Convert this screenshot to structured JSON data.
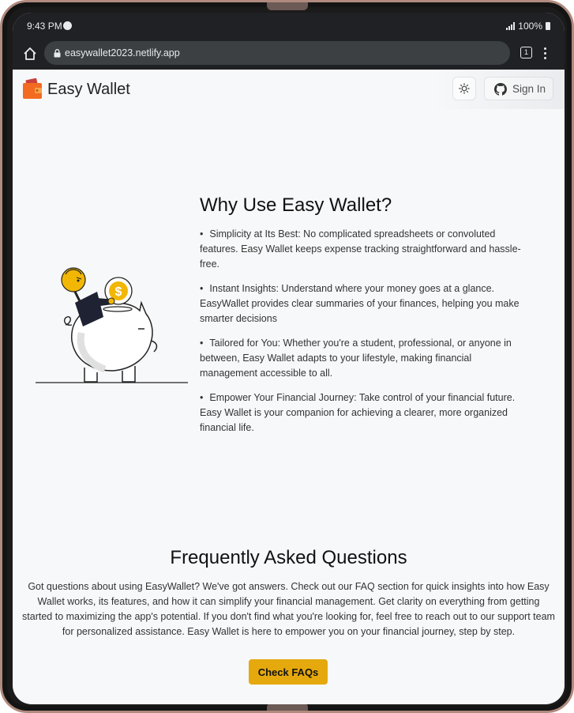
{
  "status_bar": {
    "time": "9:43 PM",
    "battery": "100%"
  },
  "browser": {
    "url": "easywallet2023.netlify.app",
    "tab_count": "1"
  },
  "header": {
    "brand": "Easy Wallet",
    "signin_label": "Sign In"
  },
  "why": {
    "title": "Why Use Easy Wallet?",
    "items": [
      "Simplicity at Its Best: No complicated spreadsheets or convoluted features. Easy Wallet keeps expense tracking straightforward and hassle-free.",
      "Instant Insights: Understand where your money goes at a glance. EasyWallet provides clear summaries of your finances, helping you make smarter decisions",
      "Tailored for You: Whether you're a student, professional, or anyone in between, Easy Wallet adapts to your lifestyle, making financial management accessible to all.",
      "Empower Your Financial Journey: Take control of your financial future. Easy Wallet is your companion for achieving a clearer, more organized financial life."
    ]
  },
  "faq": {
    "title": "Frequently Asked Questions",
    "body": "Got questions about using EasyWallet? We've got answers. Check out our FAQ section for quick insights into how Easy Wallet works, its features, and how it can simplify your financial management. Get clarity on everything from getting started to maximizing the app's potential. If you don't find what you're looking for, feel free to reach out to our support team for personalized assistance. Easy Wallet is here to empower you on your financial journey, step by step.",
    "button_label": "Check FAQs"
  },
  "icons": {
    "status": [
      "spotify-icon",
      "signal-icon",
      "battery-icon"
    ],
    "browser": [
      "home-icon",
      "lock-icon",
      "tab-switcher-icon",
      "more-vert-icon"
    ],
    "header": [
      "wallet-logo-icon",
      "sun-icon",
      "github-icon"
    ]
  },
  "colors": {
    "accent": "#e5a90d",
    "chrome": "#202124",
    "url_field": "#3c4043",
    "page_bg": "#f7f8fa"
  }
}
